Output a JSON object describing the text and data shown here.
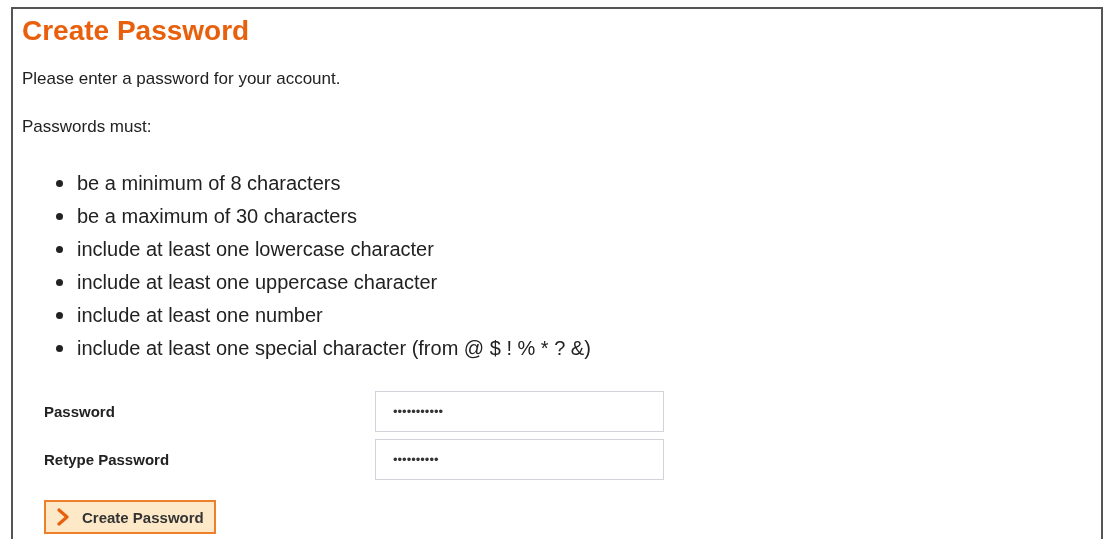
{
  "heading": "Create Password",
  "intro": "Please enter a password for your account.",
  "rules_title": "Passwords must:",
  "rules": [
    "be a minimum of 8 characters",
    "be a maximum of 30 characters",
    "include at least one lowercase character",
    "include at least one uppercase character",
    "include at least one number",
    "include at least one special character (from @ $ ! % * ? &)"
  ],
  "fields": [
    {
      "label": "Password",
      "value": "•••••••••••"
    },
    {
      "label": "Retype Password",
      "value": "••••••••••"
    }
  ],
  "submit_button": "Create Password"
}
